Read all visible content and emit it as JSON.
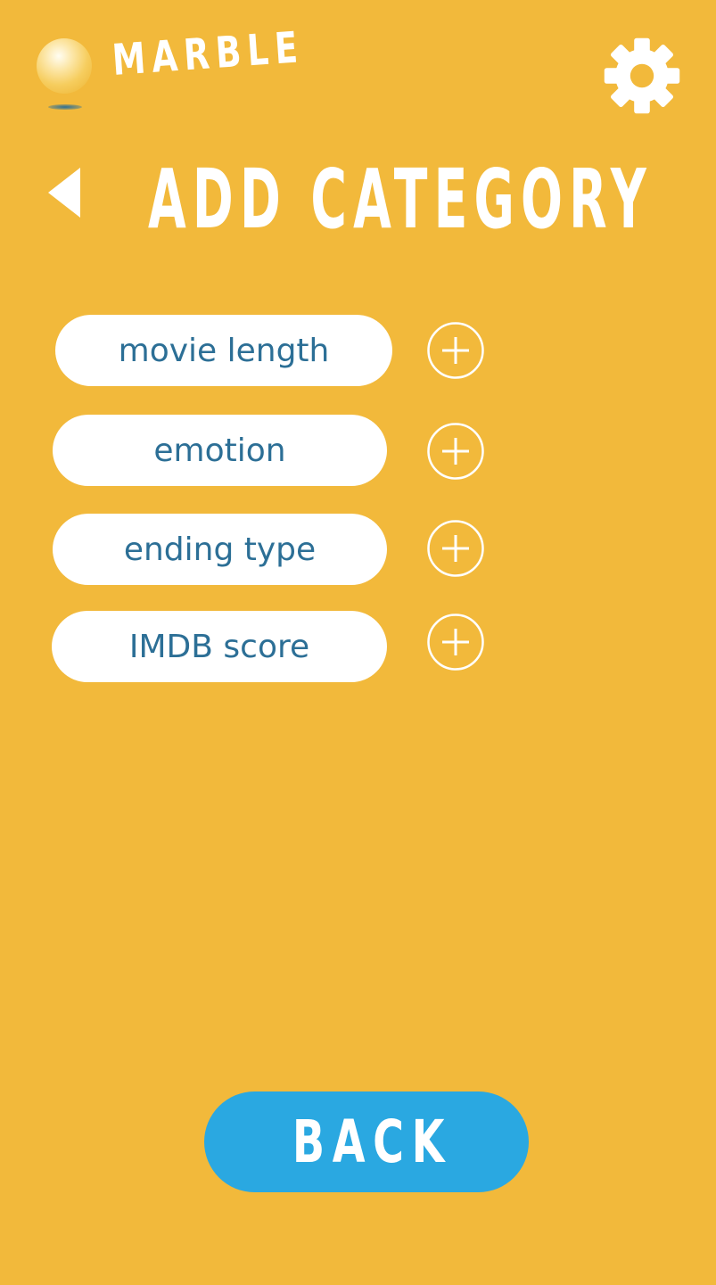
{
  "app": {
    "name": "MARBLE",
    "logo_icon": "marble-ball-icon"
  },
  "header": {
    "settings_icon": "gear-icon"
  },
  "page": {
    "title": "ADD CATEGORY",
    "back_icon": "triangle-left-icon"
  },
  "categories": [
    {
      "label": "movie length",
      "add_icon": "plus-circle-icon"
    },
    {
      "label": "emotion",
      "add_icon": "plus-circle-icon"
    },
    {
      "label": "ending type",
      "add_icon": "plus-circle-icon"
    },
    {
      "label": "IMDB score",
      "add_icon": "plus-circle-icon"
    }
  ],
  "footer": {
    "back_label": "BACK"
  },
  "colors": {
    "background": "#F2B93B",
    "text_accent": "#2C6F96",
    "button_blue": "#2AA8E1",
    "white": "#FFFFFF"
  }
}
